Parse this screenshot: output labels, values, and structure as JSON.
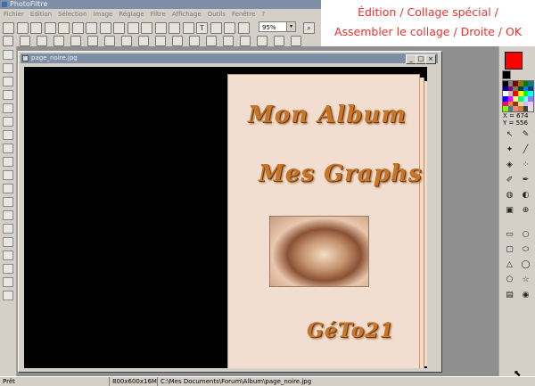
{
  "app": {
    "title": "PhotoFiltre"
  },
  "menu": [
    "Fichier",
    "Edition",
    "Sélection",
    "Image",
    "Réglage",
    "Filtre",
    "Affichage",
    "Outils",
    "Fenêtre",
    "?"
  ],
  "instruction": {
    "line1": "Édition / Collage spécial /",
    "line2": "Assembler le collage / Droite / OK",
    "color": "#e63430"
  },
  "toolbar": {
    "zoom_value": "95%",
    "zoom_chevron": "▾",
    "icons_row1": [
      "new-icon",
      "open-icon",
      "save-icon",
      "print-icon",
      "copy-icon",
      "undo-icon",
      "redo-icon",
      "cut-icon",
      "paste-icon",
      "crop-icon",
      "resize-icon",
      "paste-special-icon",
      "image-icon",
      "frame-icon",
      "text-icon",
      "mask-icon",
      "settings-icon",
      "help-icon"
    ],
    "icons_row2": [
      "auto-levels-icon",
      "contrast-icon",
      "brightness-icon",
      "color-icon",
      "hue-icon",
      "saturation-icon",
      "gamma-icon",
      "grayscale-icon",
      "sepia-icon",
      "sharpen-icon",
      "blur-icon",
      "emboss-icon",
      "water-icon",
      "drop-icon",
      "gradient-icon",
      "rotate-left-icon",
      "rotate-right-icon",
      "flip-icon"
    ],
    "icon_glyphs": {
      "text-icon": "T",
      "zoom-icon": "⌕"
    }
  },
  "document": {
    "title": "page_noire.jpg",
    "minimize_glyph": "_",
    "maximize_glyph": "□",
    "close_glyph": "×"
  },
  "book": {
    "title": "Mon Album",
    "subtitle": "Mes Graphs",
    "signature": "GéTo21"
  },
  "colors": {
    "foreground": "#ff0000",
    "background": "#000000",
    "palette": [
      "#000000",
      "#808080",
      "#800000",
      "#808000",
      "#008000",
      "#008080",
      "#000080",
      "#800080",
      "#808040",
      "#004040",
      "#0080ff",
      "#004080",
      "#ffffff",
      "#c0c0c0",
      "#ff0000",
      "#ffff00",
      "#00ff00",
      "#00ffff",
      "#0000ff",
      "#ff00ff",
      "#ffff80",
      "#00ff80",
      "#80ffff",
      "#8080ff",
      "#ff0080",
      "#ff8040",
      "#804000",
      "#ffcc99",
      "#c0c0ff",
      "#ffc0ff",
      "#80ff00",
      "#408080",
      "#ff8080",
      "#c08040",
      "#404040",
      "#e0e0e0"
    ]
  },
  "coords": {
    "x": "X = 674",
    "y": "Y = 556"
  },
  "right_tools": [
    "select-icon",
    "eyedropper-icon",
    "magic-wand-icon",
    "line-icon",
    "fill-icon",
    "spray-icon",
    "brush-icon",
    "pen-icon",
    "drop-icon",
    "blur-icon",
    "stamp-icon",
    "clone-icon",
    "rectangle-icon",
    "ellipse-icon",
    "rounded-rect-icon",
    "polygon-icon",
    "triangle-icon",
    "lasso-icon",
    "shape-icon",
    "star-icon",
    "square-select-icon",
    "circle-select-icon"
  ],
  "left_tools": [
    "frame-icon",
    "eye-icon",
    "globe-icon",
    "star-icon",
    "page-icon",
    "layers-icon",
    "gradient-icon",
    "levels-icon",
    "sharpen-icon",
    "film-icon",
    "disk-icon",
    "image-icon",
    "brush-icon",
    "folder-icon",
    "copy-icon",
    "paste-icon",
    "grid-icon",
    "lock-icon",
    "palette-icon"
  ],
  "status": {
    "ready": "Prêt",
    "dimensions": "800x600x16M",
    "path": "C:\\Mes Documents\\Forum\\Album\\page_noire.jpg"
  }
}
